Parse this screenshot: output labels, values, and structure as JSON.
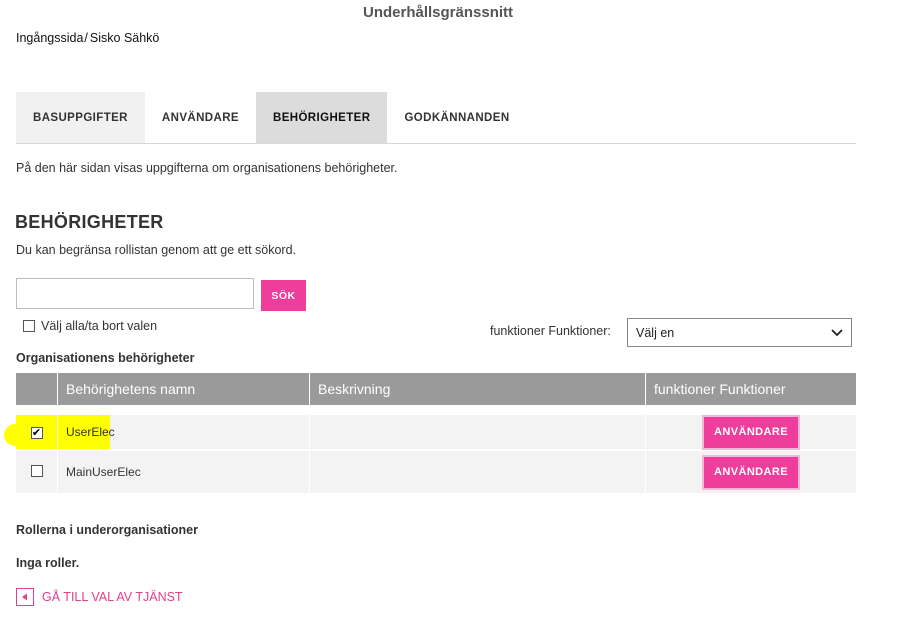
{
  "header": {
    "title": "Underhållsgränssnitt"
  },
  "breadcrumb": {
    "home": "Ingångssida",
    "separator": "/",
    "current": "Sisko Sähkö"
  },
  "tabs": [
    {
      "label": "BASUPPGIFTER"
    },
    {
      "label": "ANVÄNDARE"
    },
    {
      "label": "BEHÖRIGHETER",
      "active": true
    },
    {
      "label": "GODKÄNNANDEN"
    }
  ],
  "intro_text": "På den här sidan visas uppgifterna om organisationens behörigheter.",
  "section": {
    "title": "BEHÖRIGHETER",
    "description": "Du kan begränsa rollistan genom att ge ett sökord."
  },
  "search": {
    "value": "",
    "placeholder": "",
    "button_label": "SÖK"
  },
  "select_all_label": "Välj alla/ta bort valen",
  "functions_filter": {
    "label": "funktioner Funktioner:",
    "selected": "Välj en"
  },
  "org_table": {
    "title": "Organisationens behörigheter",
    "headers": [
      "",
      "Behörighetens namn",
      "Beskrivning",
      "funktioner Funktioner"
    ],
    "rows": [
      {
        "checked": true,
        "checkmark": "✔",
        "name": "UserElec",
        "description": "",
        "button": "ANVÄNDARE"
      },
      {
        "checked": false,
        "checkmark": "",
        "name": "MainUserElec",
        "description": "",
        "button": "ANVÄNDARE"
      }
    ]
  },
  "sub_org": {
    "title": "Rollerna i underorganisationer",
    "empty_text": "Inga roller."
  },
  "back_link": {
    "label": "GÅ TILL VAL AV TJÄNST"
  },
  "colors": {
    "accent": "#ee3d9b",
    "highlight": "#ffff00",
    "table_header": "#9a9a9a"
  },
  "icons": {
    "back": "triangle-left-icon",
    "dropdown": "chevron-down-icon"
  }
}
